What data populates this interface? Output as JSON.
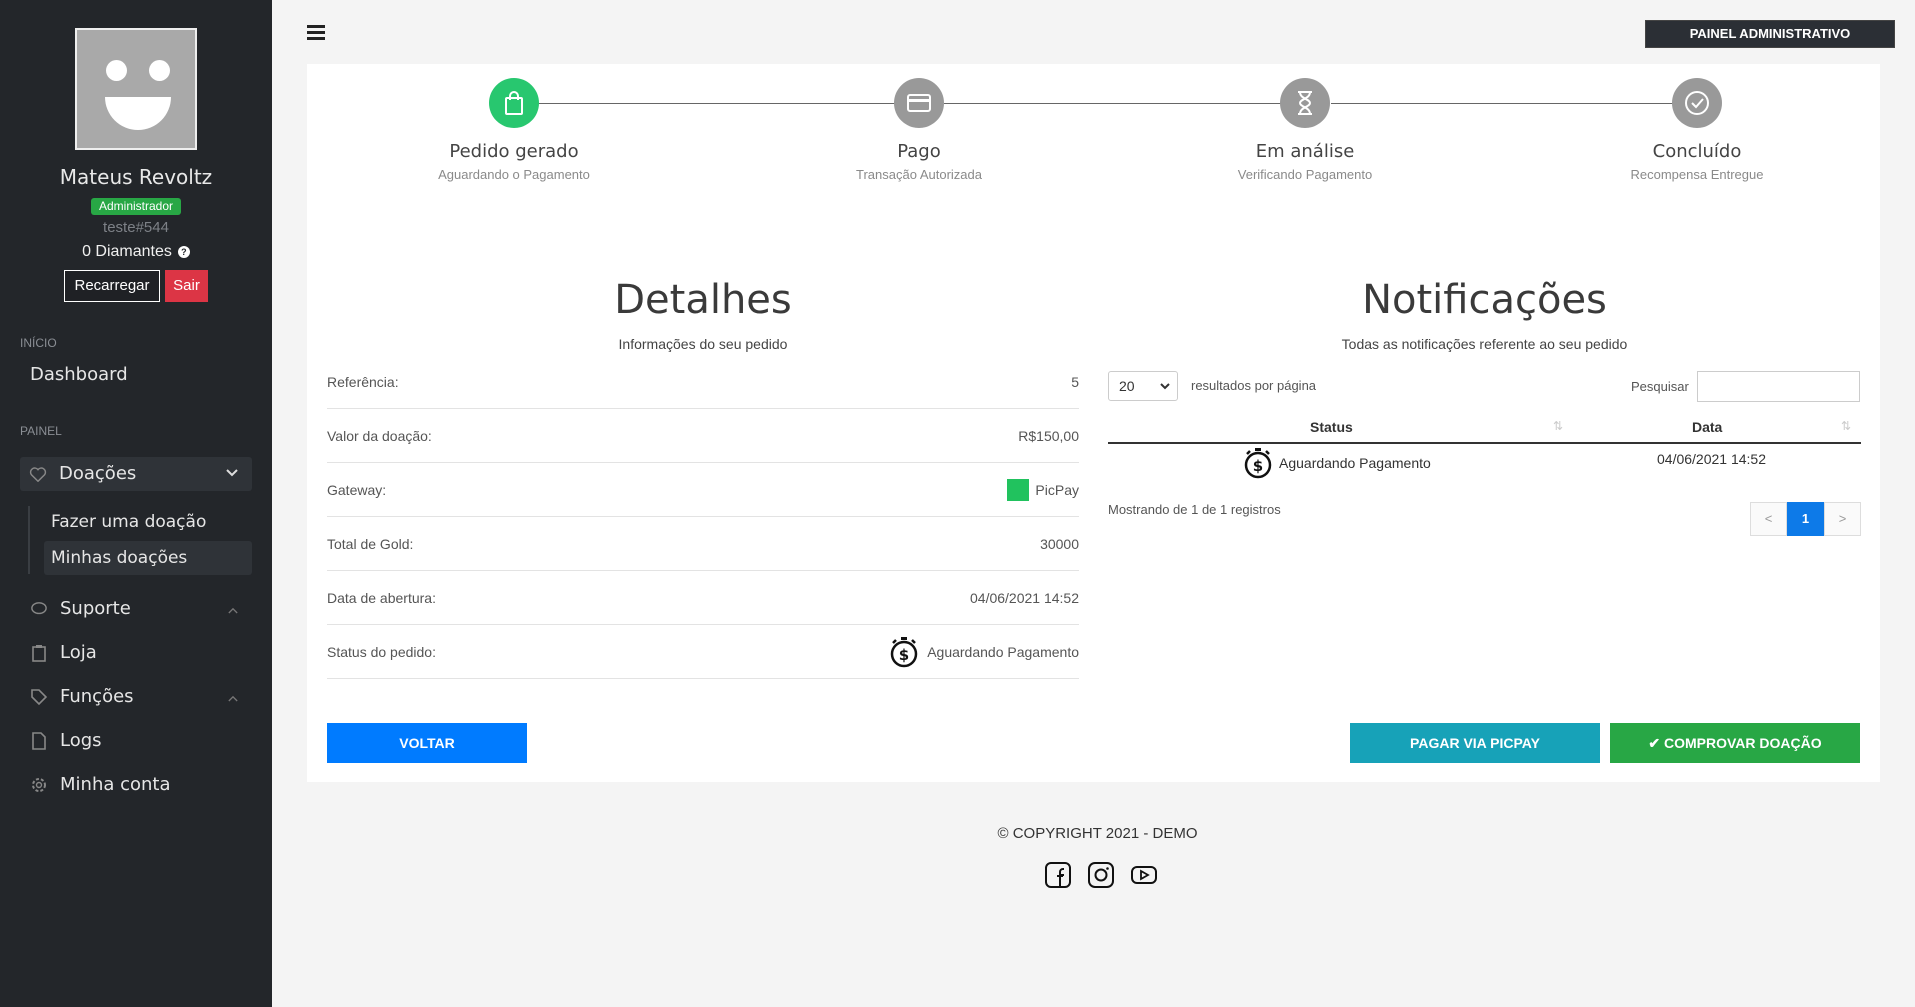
{
  "sidebar": {
    "user_name": "Mateus Revoltz",
    "role": "Administrador",
    "user_tag": "teste#544",
    "diamonds": "0 Diamantes",
    "recharge_label": "Recarregar",
    "logout_label": "Sair",
    "section_start": "INÍCIO",
    "dashboard": "Dashboard",
    "section_panel": "PAINEL",
    "donations": "Doações",
    "make_donation": "Fazer uma doação",
    "my_donations": "Minhas doações",
    "support": "Suporte",
    "store": "Loja",
    "functions": "Funções",
    "logs": "Logs",
    "my_account": "Minha conta"
  },
  "header": {
    "admin_panel": "PAINEL ADMINISTRATIVO"
  },
  "steps": [
    {
      "title": "Pedido gerado",
      "subtitle": "Aguardando o Pagamento",
      "icon": "shopping-bag-icon"
    },
    {
      "title": "Pago",
      "subtitle": "Transação Autorizada",
      "icon": "credit-card-icon"
    },
    {
      "title": "Em análise",
      "subtitle": "Verificando Pagamento",
      "icon": "hourglass-icon"
    },
    {
      "title": "Concluído",
      "subtitle": "Recompensa Entregue",
      "icon": "check-circle-icon"
    }
  ],
  "details": {
    "title": "Detalhes",
    "subtitle": "Informações do seu pedido",
    "rows": [
      {
        "label": "Referência:",
        "value": "5"
      },
      {
        "label": "Valor da doação:",
        "value": "R$150,00"
      },
      {
        "label": "Gateway:",
        "value": "PicPay"
      },
      {
        "label": "Total de Gold:",
        "value": "30000"
      },
      {
        "label": "Data de abertura:",
        "value": "04/06/2021 14:52"
      },
      {
        "label": "Status do pedido:",
        "value": "Aguardando Pagamento"
      }
    ]
  },
  "notifications": {
    "title": "Notificações",
    "subtitle": "Todas as notificações referente ao seu pedido",
    "page_size": "20",
    "results_per_page": "resultados por página",
    "search_label": "Pesquisar",
    "columns": [
      "Status",
      "Data"
    ],
    "rows": [
      {
        "status": "Aguardando Pagamento",
        "date": "04/06/2021 14:52"
      }
    ],
    "showing": "Mostrando de 1 de 1 registros",
    "prev": "<",
    "page": "1",
    "next": ">"
  },
  "actions": {
    "back": "VOLTAR",
    "pay_picpay": "PAGAR VIA PICPAY",
    "prove_donation": "COMPROVAR DOAÇÃO"
  },
  "footer": {
    "copyright": "© COPYRIGHT 2021 - DEMO"
  },
  "colors": {
    "sidebar": "#23262a",
    "success": "#28c76f",
    "primary": "#007bff",
    "info": "#17a2b8",
    "danger": "#dc3545"
  }
}
